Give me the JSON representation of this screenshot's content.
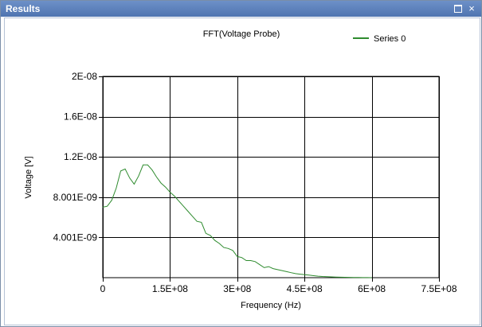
{
  "window": {
    "title": "Results",
    "close_glyph": "×"
  },
  "chart_data": {
    "type": "line",
    "title": "FFT(Voltage Probe)",
    "xlabel": "Frequency (Hz)",
    "ylabel": "Voltage [V]",
    "xlim": [
      0,
      750000000
    ],
    "ylim": [
      0,
      2e-08
    ],
    "x_ticks": [
      0,
      150000000,
      300000000,
      450000000,
      600000000,
      750000000
    ],
    "x_tick_labels": [
      "0",
      "1.5E+08",
      "3E+08",
      "4.5E+08",
      "6E+08",
      "7.5E+08"
    ],
    "y_ticks": [
      4.001e-09,
      8.001e-09,
      1.2e-08,
      1.6e-08,
      2e-08
    ],
    "y_tick_labels": [
      "4.001E-09",
      "8.001E-09",
      "1.2E-08",
      "1.6E-08",
      "2E-08"
    ],
    "grid": true,
    "legend_position": "top-right",
    "series": [
      {
        "name": "Series 0",
        "color": "#2e8b2e",
        "x": [
          0,
          10000000,
          20000000,
          30000000,
          40000000,
          50000000,
          60000000,
          70000000,
          80000000,
          90000000,
          100000000,
          110000000,
          120000000,
          130000000,
          140000000,
          150000000,
          160000000,
          170000000,
          180000000,
          190000000,
          200000000,
          210000000,
          220000000,
          230000000,
          240000000,
          250000000,
          260000000,
          270000000,
          280000000,
          290000000,
          300000000,
          310000000,
          320000000,
          330000000,
          340000000,
          350000000,
          360000000,
          370000000,
          380000000,
          390000000,
          400000000,
          410000000,
          420000000,
          430000000,
          440000000,
          450000000,
          460000000,
          470000000,
          480000000,
          490000000,
          500000000,
          510000000,
          520000000,
          530000000,
          540000000,
          550000000,
          560000000,
          570000000,
          580000000,
          590000000,
          600000000
        ],
        "values": [
          7e-09,
          7.1e-09,
          7.7e-09,
          8.9e-09,
          1.06e-08,
          1.08e-08,
          9.9e-09,
          9.3e-09,
          1.01e-08,
          1.12e-08,
          1.12e-08,
          1.07e-08,
          1e-08,
          9.4e-09,
          9e-09,
          8.5e-09,
          8.1e-09,
          7.6e-09,
          7.1e-09,
          6.6e-09,
          6.1e-09,
          5.6e-09,
          5.5e-09,
          4.4e-09,
          4.2e-09,
          3.7e-09,
          3.4e-09,
          3e-09,
          2.9e-09,
          2.7e-09,
          2.1e-09,
          2e-09,
          1.7e-09,
          1.7e-09,
          1.6e-09,
          1.3e-09,
          1e-09,
          1.1e-09,
          9e-10,
          8e-10,
          7e-10,
          6e-10,
          5e-10,
          4e-10,
          3.5e-10,
          3e-10,
          2.5e-10,
          2e-10,
          1.5e-10,
          1.2e-10,
          1e-10,
          8e-11,
          6e-11,
          5e-11,
          4e-11,
          3e-11,
          2e-11,
          1.5e-11,
          1e-11,
          5e-12,
          0
        ]
      }
    ]
  }
}
